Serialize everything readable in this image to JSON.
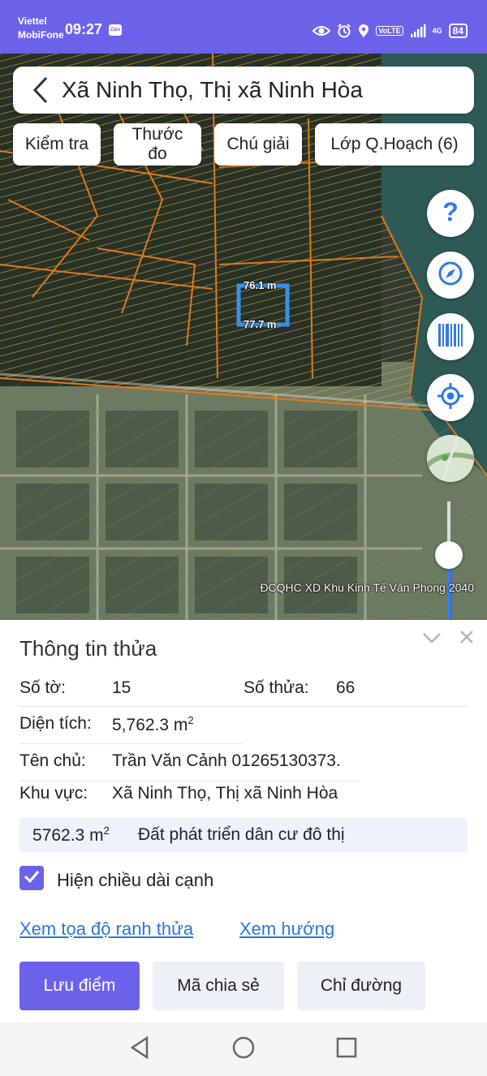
{
  "status_bar": {
    "carrier_1": "Viettel",
    "carrier_2": "MobiFone",
    "time": "09:27",
    "app_badge": "Zalo",
    "network_label": "VoLTE",
    "signal_label": "4G",
    "battery": "84"
  },
  "map": {
    "title": "Xã Ninh Thọ, Thị xã Ninh Hòa",
    "chips": {
      "check": "Kiểm tra",
      "ruler_line1": "Thước",
      "ruler_line2": "đo",
      "legend": "Chú giải",
      "layer": "Lớp Q.Hoạch (6)"
    },
    "measure_top": "76.1 m",
    "measure_bottom": "77.7 m",
    "attribution": "ĐCQHC XD Khu Kinh Tế Vân Phong 2040",
    "buttons": [
      "help-icon",
      "compass-icon",
      "barcode-icon",
      "locate-icon",
      "minimap"
    ],
    "zoom_level": 0.55,
    "colors": {
      "parcel_outline": "#e07a1a",
      "accent": "#6c62ea"
    }
  },
  "parcel_info": {
    "title": "Thông tin thửa",
    "sheet_label": "Số tờ:",
    "sheet_value": "15",
    "parcel_label": "Số thửa:",
    "parcel_value": "66",
    "area_label": "Diện tích:",
    "area_value": "5,762.3 m",
    "area_unit_sup": "2",
    "owner_label": "Tên chủ:",
    "owner_value": "Trần Văn Cảnh 01265130373.",
    "region_label": "Khu vực:",
    "region_value": "Xã Ninh Thọ, Thị xã Ninh Hòa",
    "zone_area": "5762.3 m",
    "zone_area_sup": "2",
    "zone_type": "Đất phát triển dân cư đô thị",
    "show_edges_label": "Hiện chiều dài cạnh",
    "show_edges_checked": true,
    "link_coords": "Xem tọa độ ranh thửa",
    "link_direction": "Xem hướng",
    "btn_save": "Lưu điểm",
    "btn_share": "Mã chia sẻ",
    "btn_route": "Chỉ đường"
  }
}
